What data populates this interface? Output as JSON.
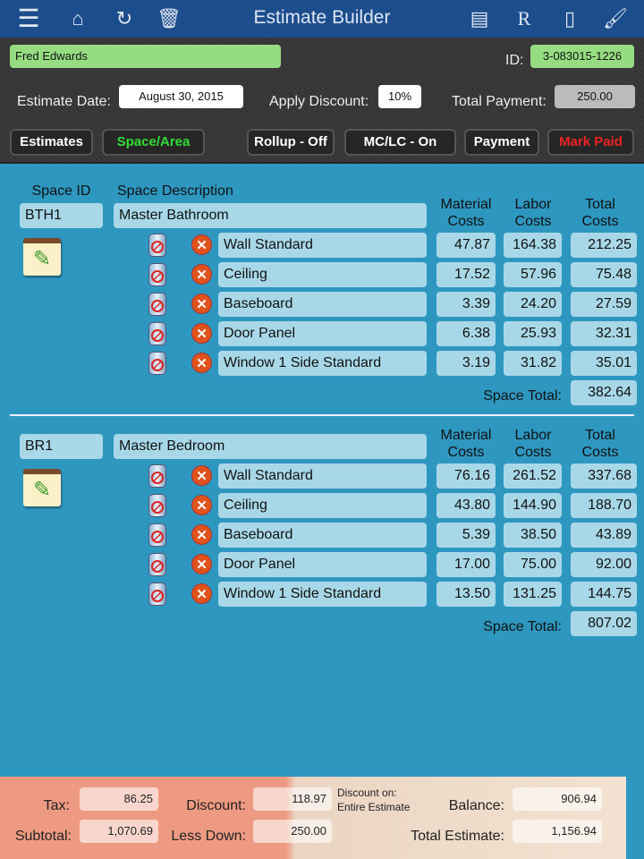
{
  "header": {
    "title": "Estimate Builder",
    "icons": [
      "menu-icon",
      "home-icon",
      "refresh-icon",
      "trash-icon",
      "file-cabinet-icon",
      "r-icon",
      "document-icon",
      "paintbrush-icon"
    ]
  },
  "customer": {
    "name": "Fred Edwards",
    "id_label": "ID:",
    "id": "3-083015-1226"
  },
  "fields": {
    "date_label": "Estimate Date:",
    "date": "August 30, 2015",
    "discount_label": "Apply Discount:",
    "discount": "10%",
    "payment_label": "Total Payment:",
    "payment": "250.00"
  },
  "buttons": {
    "estimates": "Estimates",
    "space": "Space/Area",
    "rollup": "Rollup - Off",
    "mclc": "MC/LC - On",
    "payment": "Payment",
    "markpaid": "Mark Paid"
  },
  "columns": {
    "space_id": "Space ID",
    "space_desc": "Space Description",
    "material": "Material Costs",
    "labor": "Labor Costs",
    "total": "Total Costs",
    "space_total": "Space Total:"
  },
  "spaces": [
    {
      "id": "BTH1",
      "desc": "Master Bathroom",
      "total": "382.64",
      "items": [
        {
          "name": "Wall Standard",
          "material": "47.87",
          "labor": "164.38",
          "total": "212.25"
        },
        {
          "name": "Ceiling",
          "material": "17.52",
          "labor": "57.96",
          "total": "75.48"
        },
        {
          "name": "Baseboard",
          "material": "3.39",
          "labor": "24.20",
          "total": "27.59"
        },
        {
          "name": "Door Panel",
          "material": "6.38",
          "labor": "25.93",
          "total": "32.31"
        },
        {
          "name": "Window 1 Side Standard",
          "material": "3.19",
          "labor": "31.82",
          "total": "35.01"
        }
      ]
    },
    {
      "id": "BR1",
      "desc": "Master Bedroom",
      "total": "807.02",
      "items": [
        {
          "name": "Wall Standard",
          "material": "76.16",
          "labor": "261.52",
          "total": "337.68"
        },
        {
          "name": "Ceiling",
          "material": "43.80",
          "labor": "144.90",
          "total": "188.70"
        },
        {
          "name": "Baseboard",
          "material": "5.39",
          "labor": "38.50",
          "total": "43.89"
        },
        {
          "name": "Door Panel",
          "material": "17.00",
          "labor": "75.00",
          "total": "92.00"
        },
        {
          "name": "Window 1 Side Standard",
          "material": "13.50",
          "labor": "131.25",
          "total": "144.75"
        }
      ]
    }
  ],
  "footer": {
    "tax_label": "Tax:",
    "tax": "86.25",
    "subtotal_label": "Subtotal:",
    "subtotal": "1,070.69",
    "discount_label": "Discount:",
    "discount": "118.97",
    "lessdown_label": "Less Down:",
    "lessdown": "250.00",
    "discount_note": "Discount on: Entire Estimate",
    "balance_label": "Balance:",
    "balance": "906.94",
    "total_label": "Total Estimate:",
    "total": "1,156.94"
  },
  "colors": {
    "header": "#1c4d8d",
    "main": "#2e97c0",
    "field": "#a8d8e8",
    "green": "#96dd82",
    "active_button_text": "#33dd33",
    "mark_paid_text": "#ee2222"
  }
}
